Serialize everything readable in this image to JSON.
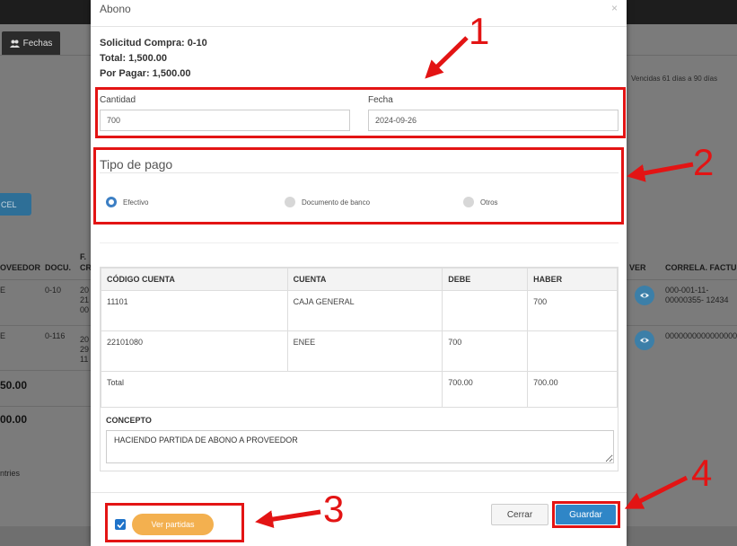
{
  "background": {
    "tab_label": "Fechas",
    "right_note": "Vencidas 61 días a 90 días",
    "excel_label": "CEL",
    "columns": {
      "proveedor": "OVEEDOR",
      "docu": "DOCU.",
      "fcr_1": "F.",
      "fcr_2": "CR",
      "ver": "VER",
      "correla": "CORRELA. FACTUR"
    },
    "rows": [
      {
        "prov": "E",
        "docu": "0-10",
        "fcr": "20\n21\n00",
        "correla": "000-001-11-\n00000355- 12434"
      },
      {
        "prov": "E",
        "docu": "0-116",
        "fcr": "20\n29\n11",
        "correla": "0000000000000000"
      }
    ],
    "total_1": "50.00",
    "total_2": "00.00",
    "entries": "ntries"
  },
  "modal": {
    "title": "Abono",
    "close": "×",
    "summary": {
      "solicitud": "Solicitud Compra: 0-10",
      "total": "Total: 1,500.00",
      "por_pagar": "Por Pagar: 1,500.00"
    },
    "cantidad": {
      "label": "Cantidad",
      "value": "700"
    },
    "fecha": {
      "label": "Fecha",
      "value": "2024-09-26"
    },
    "tipo_pago": {
      "title": "Tipo de pago",
      "options": [
        "Efectivo",
        "Documento de banco",
        "Otros"
      ],
      "selected": "Efectivo"
    },
    "table": {
      "headers": [
        "CÓDIGO CUENTA",
        "CUENTA",
        "DEBE",
        "HABER"
      ],
      "rows": [
        [
          "11101",
          "CAJA GENERAL",
          "",
          "700"
        ],
        [
          "22101080",
          "ENEE",
          "700",
          ""
        ]
      ],
      "total_label": "Total",
      "total_debe": "700.00",
      "total_haber": "700.00"
    },
    "concepto": {
      "label": "CONCEPTO",
      "value": "HACIENDO PARTIDA DE ABONO A PROVEEDOR"
    },
    "footer": {
      "ver_partidas": "Ver partidas",
      "cerrar": "Cerrar",
      "guardar": "Guardar"
    }
  },
  "annotations": {
    "color": "#e31414",
    "labels": [
      "1",
      "2",
      "3",
      "4"
    ]
  }
}
